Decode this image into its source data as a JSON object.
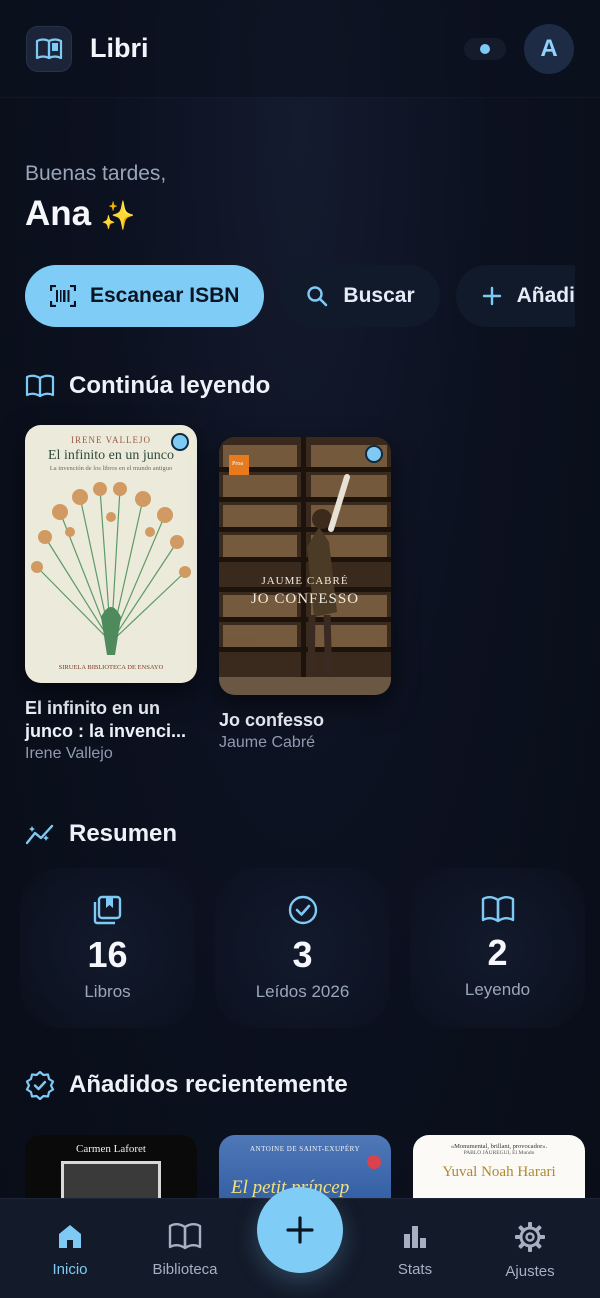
{
  "app": {
    "title": "Libri",
    "avatar_initial": "A",
    "accent": "#7fcdf7"
  },
  "greeting": {
    "salutation": "Buenas tardes,",
    "name": "Ana",
    "emoji": "✨"
  },
  "actions": [
    {
      "label": "Escanear ISBN",
      "icon": "barcode-scan-icon"
    },
    {
      "label": "Buscar",
      "icon": "search-icon"
    },
    {
      "label": "Añadi",
      "icon": "plus-icon"
    }
  ],
  "continue_reading": {
    "title": "Continúa leyendo",
    "books": [
      {
        "title": "El infinito en un junco : la invenci...",
        "author": "Irene Vallejo",
        "cover": {
          "author": "IRENE VALLEJO",
          "title": "El infinito en un junco",
          "subtitle": "La invención de los libros en el mundo antiguo",
          "publisher": "SIRUELA BIBLIOTECA DE ENSAYO"
        }
      },
      {
        "title": "Jo confesso",
        "author": "Jaume Cabré",
        "cover": {
          "author": "JAUME CABRÉ",
          "title": "JO CONFESSO",
          "badge": "Proa"
        }
      }
    ]
  },
  "summary": {
    "title": "Resumen",
    "stats": [
      {
        "value": "16",
        "label": "Libros",
        "icon": "books-icon"
      },
      {
        "value": "3",
        "label": "Leídos 2026",
        "icon": "check-circle-icon"
      },
      {
        "value": "2",
        "label": "Leyendo",
        "icon": "open-book-icon"
      }
    ]
  },
  "recent": {
    "title": "Añadidos recientemente",
    "covers": [
      {
        "author": "Carmen Laforet"
      },
      {
        "author": "ANTOINE DE SAINT-EXUPÉRY",
        "title": "El petit príncep"
      },
      {
        "quote": "«Monumental, brillant, provocador».",
        "source": "PABLO JÁUREGUI, El Mundo",
        "author": "Yuval Noah Harari"
      }
    ]
  },
  "nav": [
    {
      "label": "Inicio",
      "icon": "home-icon",
      "active": true
    },
    {
      "label": "Biblioteca",
      "icon": "library-icon",
      "active": false
    },
    {
      "label": "Stats",
      "icon": "bar-chart-icon",
      "active": false
    },
    {
      "label": "Ajustes",
      "icon": "gear-icon",
      "active": false
    }
  ]
}
